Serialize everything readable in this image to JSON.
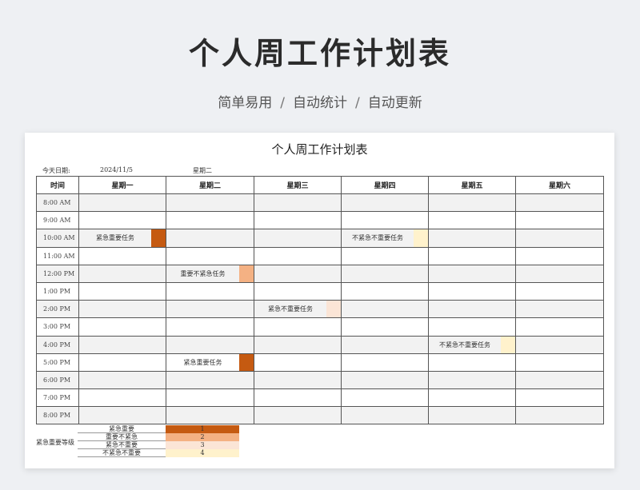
{
  "header": {
    "title": "个人周工作计划表",
    "subtitle_parts": [
      "简单易用",
      "/",
      "自动统计",
      "/",
      "自动更新"
    ]
  },
  "sheet": {
    "title": "个人周工作计划表",
    "date_label": "今天日期:",
    "date_value": "2024/11/5",
    "weekday": "星期二",
    "time_header": "时间",
    "days": [
      "星期一",
      "星期二",
      "星期三",
      "星期四",
      "星期五",
      "星期六"
    ],
    "times": [
      "8:00 AM",
      "9:00 AM",
      "10:00 AM",
      "11:00 AM",
      "12:00 PM",
      "1:00 PM",
      "2:00 PM",
      "3:00 PM",
      "4:00 PM",
      "5:00 PM",
      "6:00 PM",
      "7:00 PM",
      "8:00 PM"
    ],
    "tasks": [
      {
        "time_index": 2,
        "day_index": 0,
        "text": "紧急重要任务",
        "color": "#c55a11"
      },
      {
        "time_index": 2,
        "day_index": 3,
        "text": "不紧急不重要任务",
        "color": "#fff2cc"
      },
      {
        "time_index": 4,
        "day_index": 1,
        "text": "重要不紧急任务",
        "color": "#f4b183"
      },
      {
        "time_index": 6,
        "day_index": 2,
        "text": "紧急不重要任务",
        "color": "#fbe5d6"
      },
      {
        "time_index": 8,
        "day_index": 4,
        "text": "不紧急不重要任务",
        "color": "#fff2cc"
      },
      {
        "time_index": 9,
        "day_index": 1,
        "text": "紧急重要任务",
        "color": "#c55a11"
      }
    ],
    "legend": {
      "title": "紧急重要等级",
      "items": [
        {
          "label": "紧急重要",
          "level": "1",
          "color": "#c55a11"
        },
        {
          "label": "重要不紧急",
          "level": "2",
          "color": "#f4b183"
        },
        {
          "label": "紧急不重要",
          "level": "3",
          "color": "#fbe5d6"
        },
        {
          "label": "不紧急不重要",
          "level": "4",
          "color": "#fff2cc"
        }
      ]
    }
  }
}
